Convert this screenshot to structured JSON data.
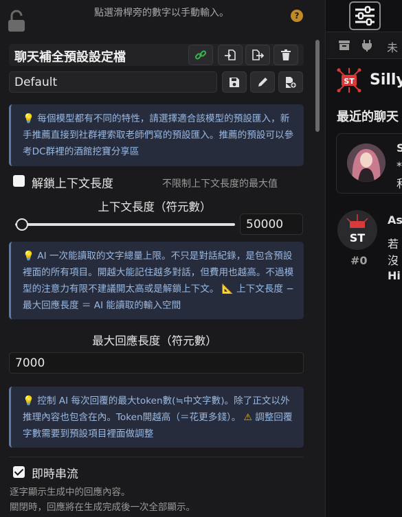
{
  "left_panel": {
    "top_hint": "點選滑桿旁的數字以手動輸入。",
    "help_label": "?",
    "preset_title": "聊天補全預設設定檔",
    "preset_select": {
      "value": "Default"
    },
    "note1": "每個模型都有不同的特性，請選擇適合該模型的預設匯入，新手推薦直接到社群裡索取老師們寫的預設匯入。推薦的預設可以參考DC群裡的酒館挖寶分享區",
    "unlock_context": {
      "label": "解鎖上下文長度",
      "hint": "不限制上下文長度的最大值",
      "checked": false
    },
    "context_length": {
      "title": "上下文長度（符元數）",
      "value": "50000",
      "slider_fraction": 0.03
    },
    "note2": "AI 一次能讀取的文字總量上限。不只是對話紀錄，是包含預設裡面的所有項目。開越大能記住越多對話，但費用也越高。不過模型的注意力有限不建議開太高或是解鎖上下文。",
    "note2_tail": "上下文長度 − 最大回應長度 ＝ AI 能讀取的輸入空間",
    "max_response": {
      "title": "最大回應長度（符元數）",
      "value": "7000"
    },
    "note3": "控制 AI 每次回覆的最大token數(≒中文字數)。除了正文以外推理內容也包含在內。Token開越高（＝花更多錢）。",
    "note3_tail": "調整回覆字數需要到預設項目裡面做調整",
    "streaming": {
      "label": "即時串流",
      "checked": true,
      "desc1": "逐字顯示生成中的回應內容。",
      "desc2": "關閉時，回應將在生成完成後一次全部顯示。"
    }
  },
  "right_panel": {
    "tab_text": "未",
    "logo_text": "Silly",
    "heading": "最近的聊天",
    "card_letters": [
      "S",
      "*",
      "和"
    ],
    "message_name": "As",
    "message_line": "若沒",
    "message_index": "#0",
    "message_greet": "Hi"
  },
  "colors": {
    "accent_note_text": "#9ab9e2",
    "note_bg": "#262c3c",
    "link_green": "#3cb44b",
    "brand_red": "#d83a3a"
  }
}
